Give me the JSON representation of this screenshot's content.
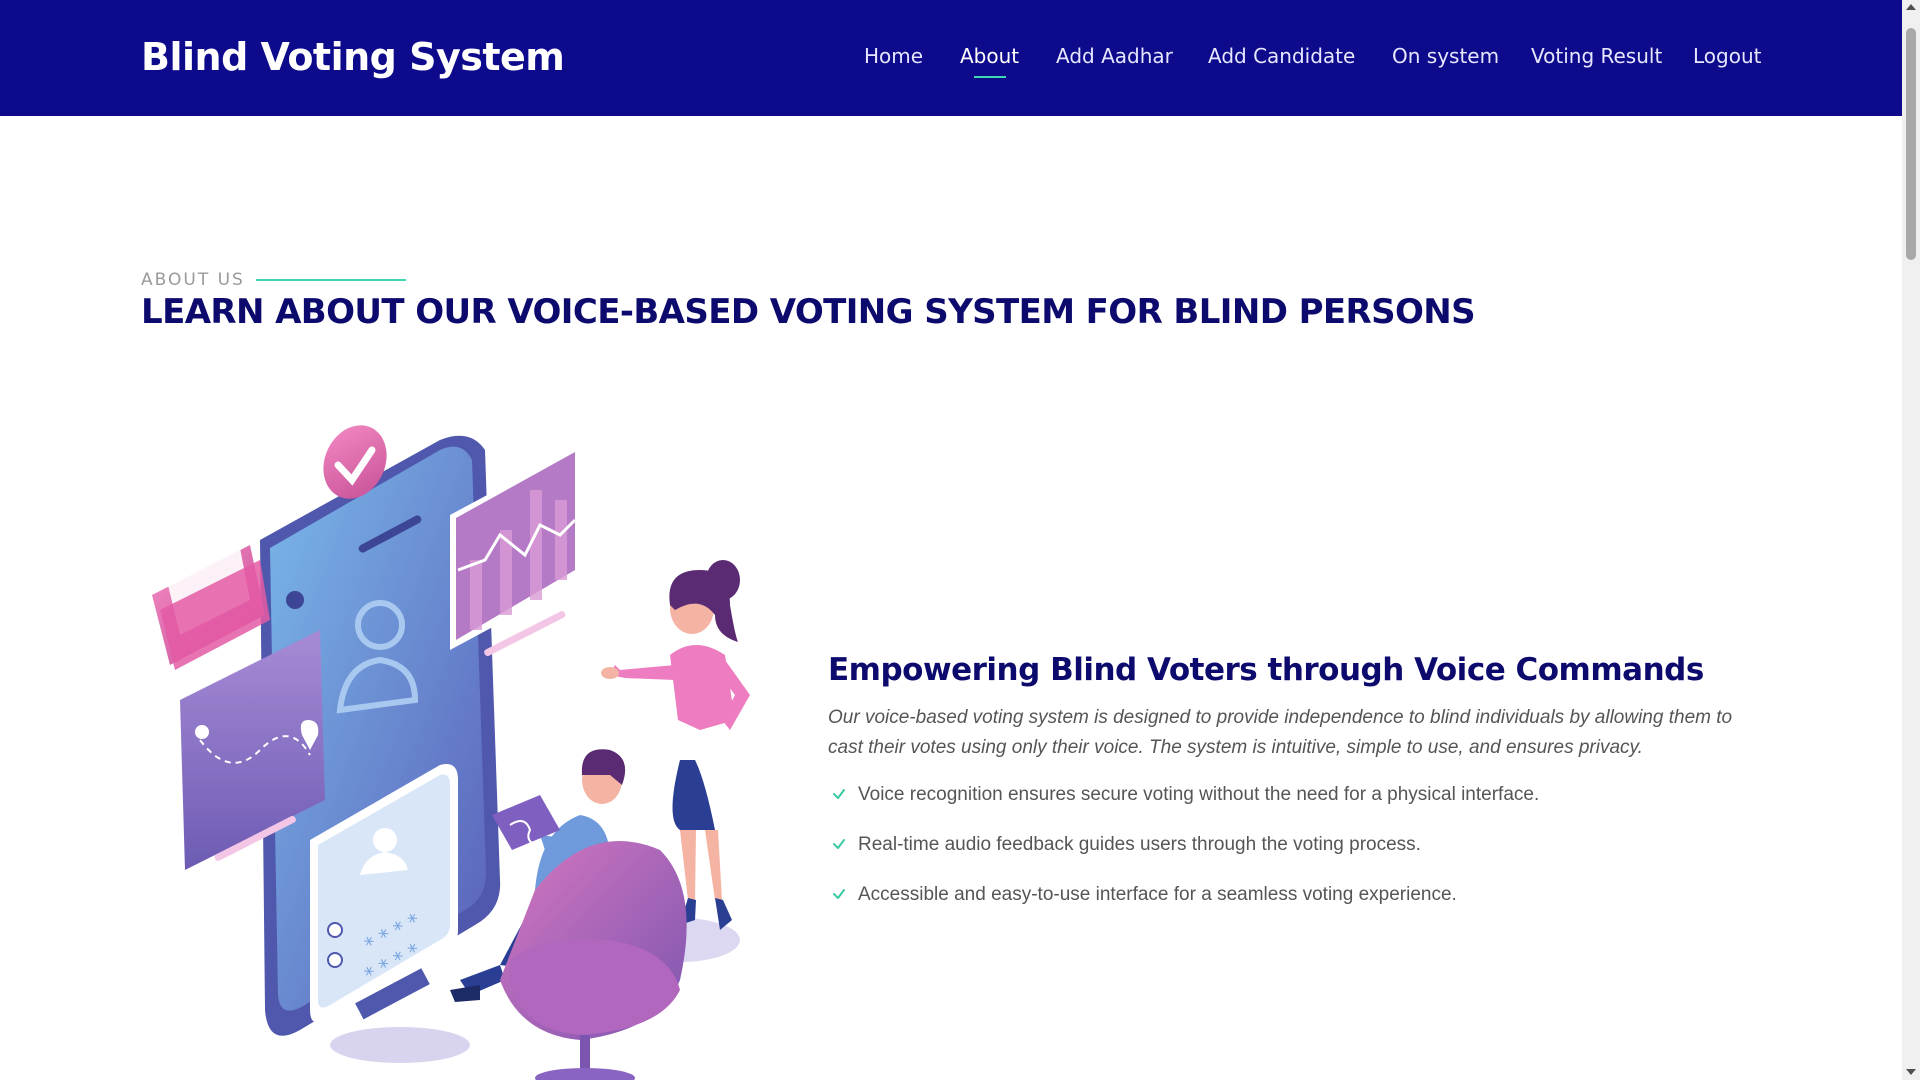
{
  "header": {
    "brand": "Blind Voting System",
    "nav": [
      {
        "label": "Home",
        "active": false
      },
      {
        "label": "About",
        "active": true
      },
      {
        "label": "Add Aadhar",
        "active": false
      },
      {
        "label": "Add Candidate",
        "active": false
      },
      {
        "label": "On system",
        "active": false
      },
      {
        "label": "Voting Result",
        "active": false
      },
      {
        "label": "Logout",
        "active": false
      }
    ]
  },
  "about": {
    "eyebrow": "ABOUT US",
    "title": "LEARN ABOUT OUR VOICE-BASED VOTING SYSTEM FOR BLIND PERSONS",
    "content_title": "Empowering Blind Voters through Voice Commands",
    "description": "Our voice-based voting system is designed to provide independence to blind individuals by allowing them to cast their votes using only their voice. The system is intuitive, simple to use, and ensures privacy.",
    "features": [
      "Voice recognition ensures secure voting without the need for a physical interface.",
      "Real-time audio feedback guides users through the voting process.",
      "Accessible and easy-to-use interface for a seamless voting experience."
    ],
    "illustration_icon": "voting-app-illustration",
    "check_icon": "check-icon"
  },
  "colors": {
    "header_bg": "#0d0a8c",
    "accent": "#40d6b0",
    "title": "#0d0a6e"
  }
}
